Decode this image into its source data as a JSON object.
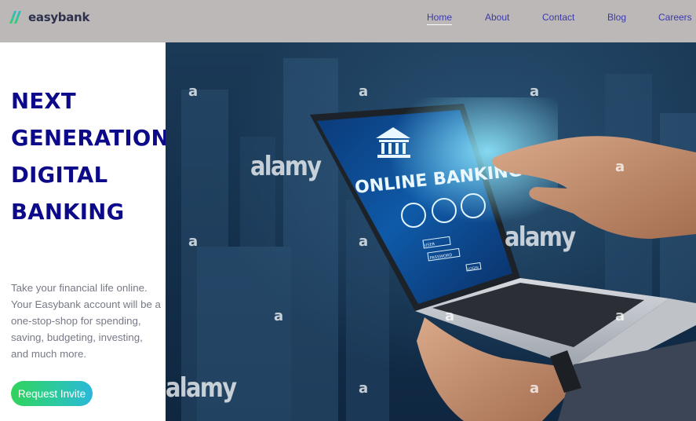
{
  "brand": {
    "name": "easybank",
    "logo_icon": "easybank-logo-icon"
  },
  "nav": {
    "items": [
      {
        "label": "Home",
        "active": true
      },
      {
        "label": "About",
        "active": false
      },
      {
        "label": "Contact",
        "active": false
      },
      {
        "label": "Blog",
        "active": false
      },
      {
        "label": "Careers",
        "active": false
      }
    ]
  },
  "hero": {
    "headline_lines": [
      "NEXT",
      "GENERATION",
      "DIGITAL",
      "BANKING"
    ],
    "intro_lines": [
      "Take your financial life online.",
      "Your Easybank account will be a",
      "one-stop-shop for spending,",
      "saving, budgeting, investing,",
      "and much more."
    ],
    "cta_label": "Request Invite"
  },
  "image": {
    "screen_title": "ONLINE BANKING",
    "screen_fields": [
      "USER",
      "PASSWORD",
      "LOGIN"
    ],
    "watermark_word": "alamy",
    "watermark_letter": "a"
  },
  "colors": {
    "header_bg": "#bdb8b8",
    "headline": "#0d0a8a",
    "nav_link": "#3a3aa8",
    "cta_gradient_start": "#31d35c",
    "cta_gradient_end": "#2bb7da"
  }
}
